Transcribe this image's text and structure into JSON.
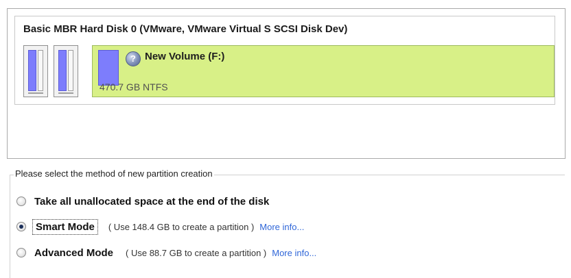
{
  "disk": {
    "title": "Basic MBR Hard Disk 0 (VMware, VMware Virtual S SCSI Disk Dev)",
    "volume": {
      "name": "New Volume (F:)",
      "size": "470.7 GB NTFS",
      "icon": "help-icon"
    }
  },
  "creation": {
    "legend": "Please select the method of new partition creation",
    "options": [
      {
        "label": "Take all unallocated space at the end of the disk",
        "checked": false
      },
      {
        "label": "Smart Mode",
        "note": "( Use 148.4 GB to create a partition )",
        "link": "More info...",
        "checked": true
      },
      {
        "label": "Advanced Mode",
        "note": "( Use 88.7 GB to create a partition )",
        "link": "More info...",
        "checked": false
      }
    ]
  },
  "colors": {
    "volume_fill": "#d8f087",
    "partition_bar": "#7d7dfc",
    "link": "#2f66d8"
  }
}
